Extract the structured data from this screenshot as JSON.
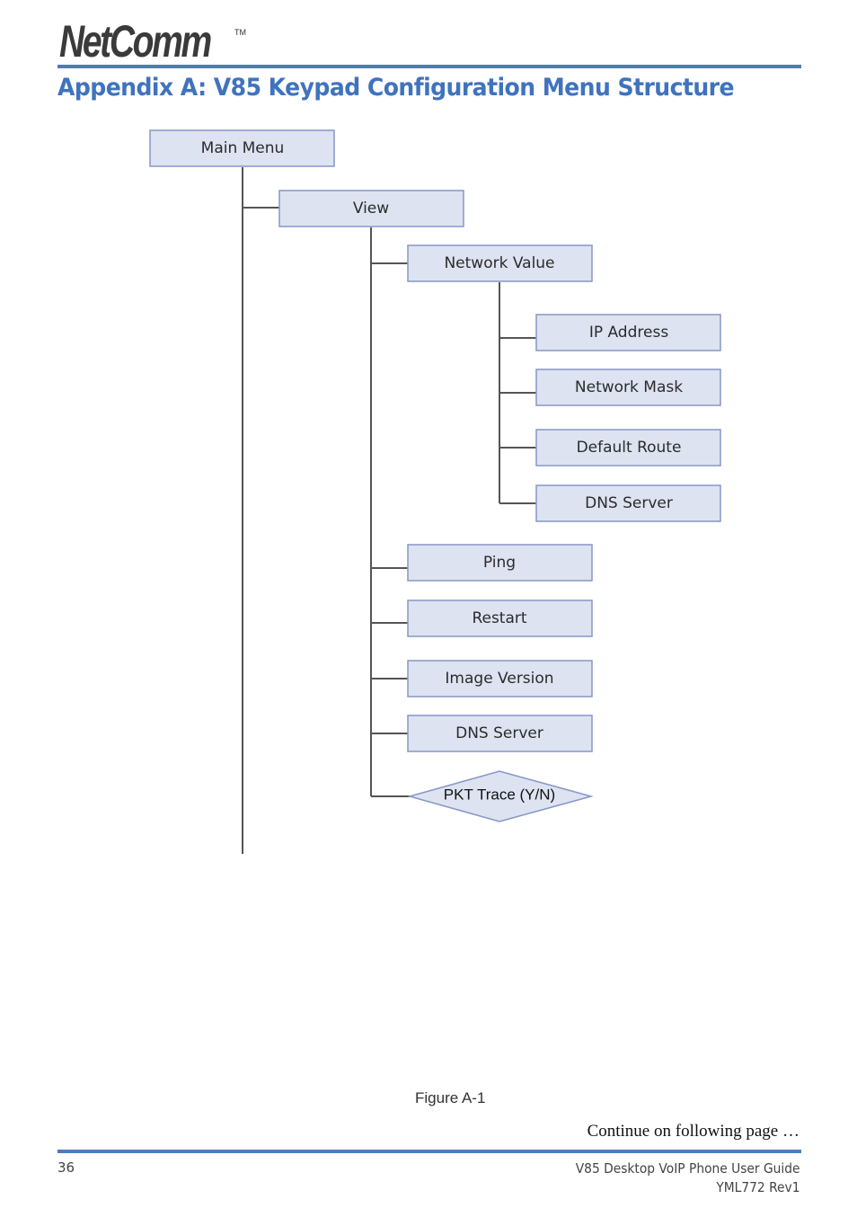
{
  "header": {
    "logo_text": "NetComm",
    "trademark": "TM",
    "title": "Appendix A:  V85 Keypad Configuration Menu Structure"
  },
  "diagram": {
    "root": "Main Menu",
    "view": "View",
    "network_value": "Network Value",
    "network_children": [
      "IP Address",
      "Network Mask",
      "Default Route",
      "DNS Server"
    ],
    "view_children": [
      "Ping",
      "Restart",
      "Image Version",
      "DNS Server"
    ],
    "decision": "PKT Trace (Y/N)",
    "colors": {
      "box_fill": "#dde3f1",
      "box_border": "#8797c6",
      "line": "#555555"
    }
  },
  "caption": "Figure A-1",
  "continue_text": "Continue on following page …",
  "footer": {
    "page_number": "36",
    "guide_title": "V85 Desktop VoIP Phone User Guide",
    "doc_code": "YML772 Rev1"
  }
}
